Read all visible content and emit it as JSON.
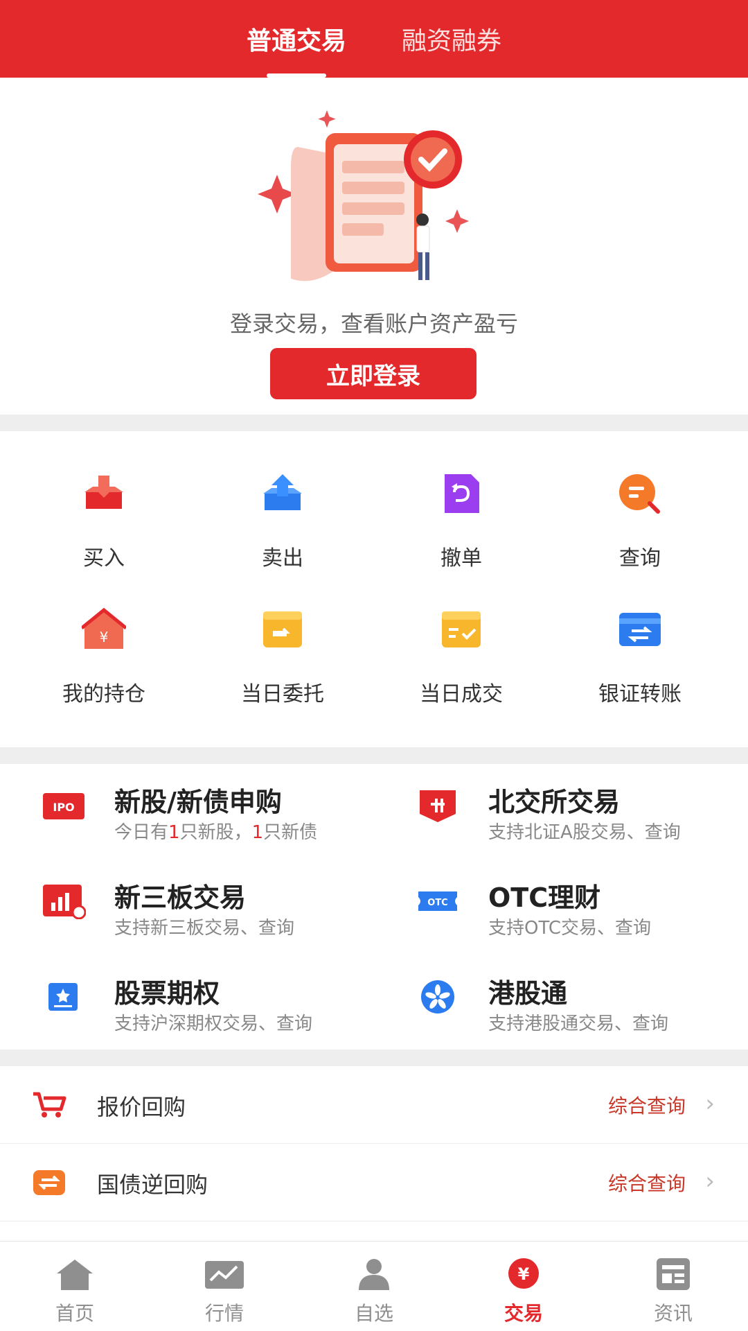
{
  "header": {
    "tabs": [
      {
        "label": "普通交易",
        "active": true
      },
      {
        "label": "融资融券",
        "active": false
      }
    ]
  },
  "hero": {
    "message": "登录交易，查看账户资产盈亏",
    "login_button": "立即登录"
  },
  "grid": [
    {
      "label": "买入",
      "icon": "buy-icon"
    },
    {
      "label": "卖出",
      "icon": "sell-icon"
    },
    {
      "label": "撤单",
      "icon": "cancel-order-icon"
    },
    {
      "label": "查询",
      "icon": "query-icon"
    },
    {
      "label": "我的持仓",
      "icon": "holdings-icon"
    },
    {
      "label": "当日委托",
      "icon": "today-orders-icon"
    },
    {
      "label": "当日成交",
      "icon": "today-deals-icon"
    },
    {
      "label": "银证转账",
      "icon": "bank-transfer-icon"
    }
  ],
  "services": [
    {
      "title": "新股/新债申购",
      "sub_parts": [
        "今日有",
        "1",
        "只新股，",
        "1",
        "只新债"
      ],
      "icon": "ipo-icon"
    },
    {
      "title": "北交所交易",
      "sub": "支持北证A股交易、查询",
      "icon": "bse-icon"
    },
    {
      "title": "新三板交易",
      "sub": "支持新三板交易、查询",
      "icon": "neeq-icon"
    },
    {
      "title": "OTC理财",
      "sub": "支持OTC交易、查询",
      "icon": "otc-icon"
    },
    {
      "title": "股票期权",
      "sub": "支持沪深期权交易、查询",
      "icon": "options-icon"
    },
    {
      "title": "港股通",
      "sub": "支持港股通交易、查询",
      "icon": "hk-connect-icon"
    }
  ],
  "rows": [
    {
      "label": "报价回购",
      "link": "综合查询",
      "icon": "cart-icon"
    },
    {
      "label": "国债逆回购",
      "link": "综合查询",
      "icon": "repo-icon"
    }
  ],
  "bottom_nav": [
    {
      "label": "首页",
      "icon": "home-icon",
      "active": false
    },
    {
      "label": "行情",
      "icon": "market-icon",
      "active": false
    },
    {
      "label": "自选",
      "icon": "watchlist-icon",
      "active": false
    },
    {
      "label": "交易",
      "icon": "trade-icon",
      "active": true
    },
    {
      "label": "资讯",
      "icon": "news-icon",
      "active": false
    }
  ],
  "colors": {
    "brand": "#e4292c",
    "link": "#c8382a"
  }
}
